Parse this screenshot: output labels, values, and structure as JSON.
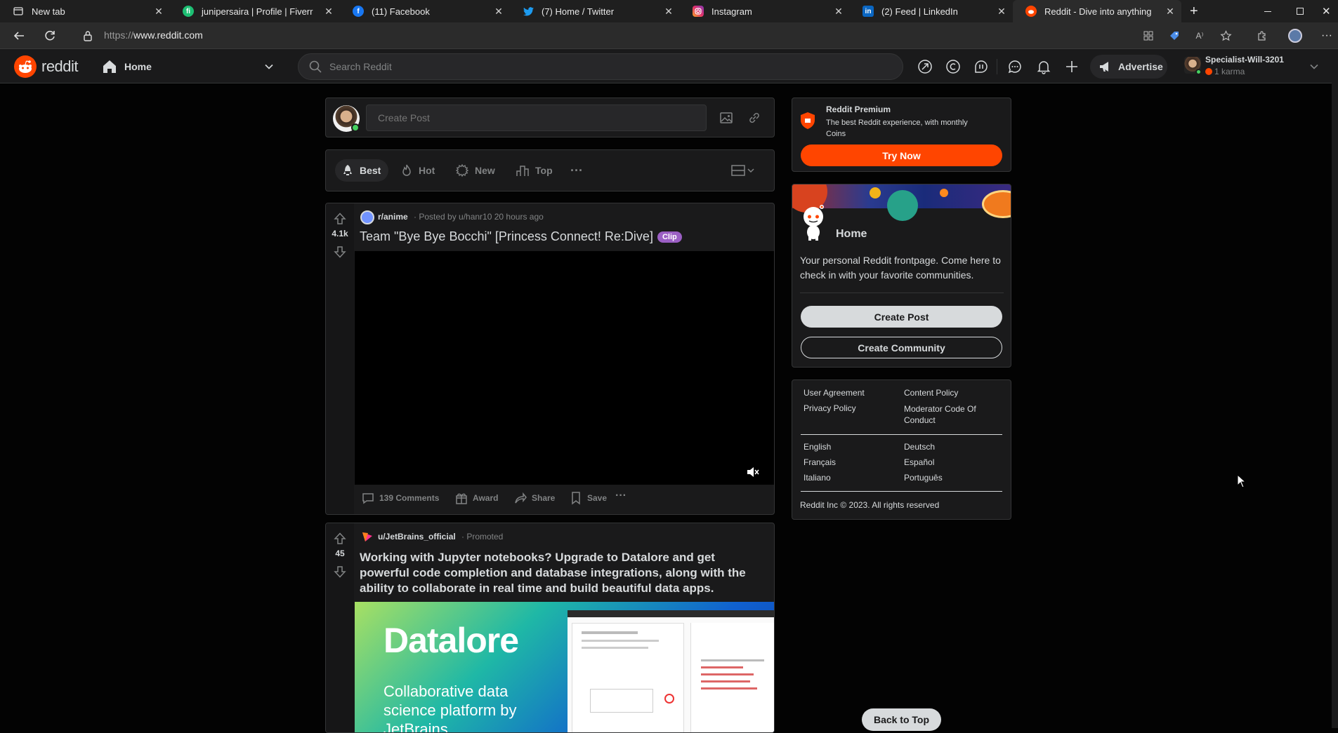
{
  "browser": {
    "tabs": [
      {
        "title": "New tab",
        "icon": "newtab-icon"
      },
      {
        "title": "junipersaira | Profile | Fiverr",
        "icon": "fiverr-icon"
      },
      {
        "title": "(11) Facebook",
        "icon": "facebook-icon"
      },
      {
        "title": "(7) Home / Twitter",
        "icon": "twitter-icon"
      },
      {
        "title": "Instagram",
        "icon": "instagram-icon"
      },
      {
        "title": "(2) Feed | LinkedIn",
        "icon": "linkedin-icon"
      },
      {
        "title": "Reddit - Dive into anything",
        "icon": "reddit-icon",
        "active": true
      }
    ],
    "url_prefix": "https://",
    "url_host": "www.reddit.com"
  },
  "header": {
    "logo_text": "reddit",
    "feed_label": "Home",
    "search_placeholder": "Search Reddit",
    "advertise_label": "Advertise",
    "username": "Specialist-Will-3201",
    "karma": "1 karma"
  },
  "create_post": {
    "placeholder": "Create Post"
  },
  "sort": {
    "best": "Best",
    "hot": "Hot",
    "new": "New",
    "top": "Top"
  },
  "posts": [
    {
      "votes": "4.1k",
      "subreddit": "r/anime",
      "posted_by": "· Posted by u/hanr10 20 hours ago",
      "title": "Team \"Bye Bye Bocchi\" [Princess Connect! Re:Dive]",
      "flair": "Clip",
      "comments": "139 Comments",
      "award": "Award",
      "share": "Share",
      "save": "Save"
    },
    {
      "votes": "45",
      "author": "u/JetBrains_official",
      "promoted": "· Promoted",
      "title": "Working with Jupyter notebooks? Upgrade to Datalore and get powerful code completion and database integrations, along with the ability to collaborate in real time and build beautiful data apps.",
      "ad_brand": "Datalore",
      "ad_tagline": "Collaborative data science platform by JetBrains"
    }
  ],
  "premium": {
    "title": "Reddit Premium",
    "desc": "The best Reddit experience, with monthly Coins",
    "button": "Try Now"
  },
  "home_card": {
    "title": "Home",
    "desc": "Your personal Reddit frontpage. Come here to check in with your favorite communities.",
    "create_post": "Create Post",
    "create_community": "Create Community"
  },
  "footer": {
    "links_left": [
      "User Agreement",
      "Privacy Policy"
    ],
    "links_right": [
      "Content Policy",
      "Moderator Code Of Conduct"
    ],
    "langs_left": [
      "English",
      "Français",
      "Italiano"
    ],
    "langs_right": [
      "Deutsch",
      "Español",
      "Português"
    ],
    "copyright": "Reddit Inc © 2023. All rights reserved"
  },
  "back_to_top": "Back to Top",
  "colors": {
    "accent": "#ff4500",
    "flair": "#9b5fc4",
    "upvote": "#818384"
  }
}
